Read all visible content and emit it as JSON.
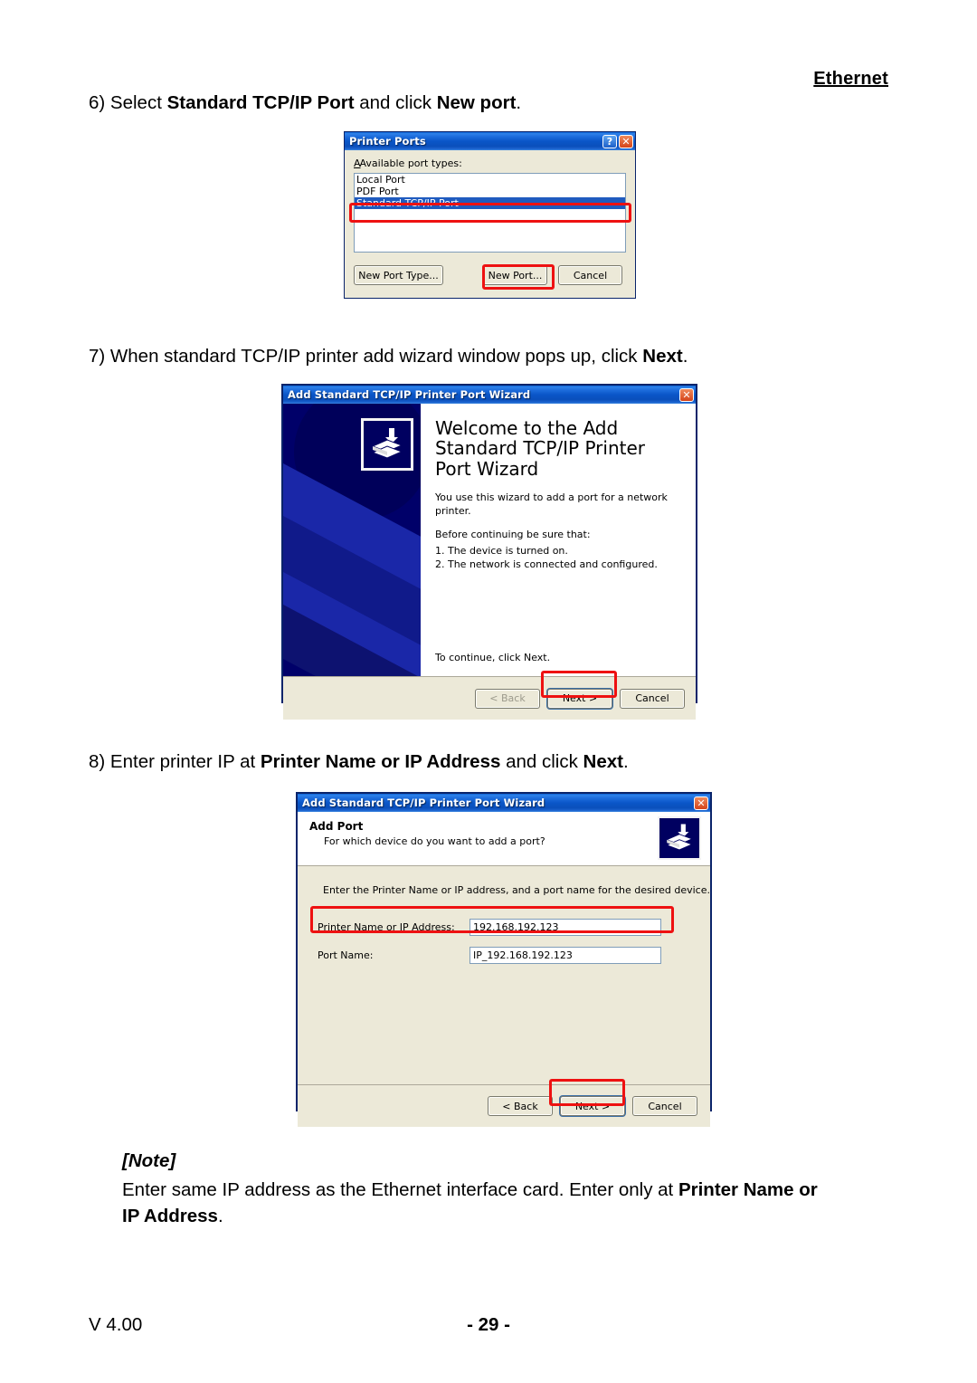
{
  "page": {
    "header_right": "Ethernet",
    "footer_left": "V 4.00",
    "footer_center": "- 29 -"
  },
  "steps": {
    "step6": {
      "prefix": "6) Select ",
      "bold1": "Standard TCP/IP Port",
      "middle": " and click ",
      "bold2": "New port",
      "suffix": "."
    },
    "step7": {
      "prefix": "7) When standard TCP/IP printer add wizard window pops up, click ",
      "bold1": "Next",
      "suffix": "."
    },
    "step8": {
      "prefix": "8) Enter printer IP at ",
      "bold1": "Printer Name or IP Address",
      "middle": " and click ",
      "bold2": "Next",
      "suffix": "."
    }
  },
  "note": {
    "label": "[Note]",
    "part1": "Enter same IP address as the Ethernet interface card. Enter only at ",
    "bold1": "Printer Name or",
    "bold2": "IP Address",
    "suffix": "."
  },
  "printer_ports_dialog": {
    "title": "Printer Ports",
    "help_glyph": "?",
    "close_glyph": "✕",
    "list_label": "Available port types:",
    "port_types": [
      {
        "label": "Local Port",
        "selected": false
      },
      {
        "label": "PDF Port",
        "selected": false
      },
      {
        "label": "Standard TCP/IP Port",
        "selected": true
      }
    ],
    "buttons": {
      "new_port_type": "New Port Type...",
      "new_port": "New Port...",
      "cancel": "Cancel"
    }
  },
  "wizard_welcome_dialog": {
    "title": "Add Standard TCP/IP Printer Port Wizard",
    "close_glyph": "✕",
    "heading": "Welcome to the Add Standard TCP/IP Printer Port Wizard",
    "intro": "You use this wizard to add a port for a network printer.",
    "before_label": "Before continuing be sure that:",
    "checklist": [
      "1.  The device is turned on.",
      "2.  The network is connected and configured."
    ],
    "continue_text": "To continue, click Next.",
    "buttons": {
      "back": "< Back",
      "next": "Next >",
      "cancel": "Cancel"
    }
  },
  "add_port_dialog": {
    "title": "Add Standard TCP/IP Printer Port Wizard",
    "close_glyph": "✕",
    "section_title": "Add Port",
    "section_subtitle": "For which device do you want to add a port?",
    "intro": "Enter the Printer Name or IP address, and a port name for the desired device.",
    "fields": [
      {
        "label": "Printer Name or IP Address:",
        "value": "192.168.192.123"
      },
      {
        "label": "Port Name:",
        "value": "IP_192.168.192.123"
      }
    ],
    "buttons": {
      "back": "< Back",
      "next": "Next >",
      "cancel": "Cancel"
    }
  },
  "colors": {
    "highlight_ring": "#ee1111",
    "titlebar_blue": "#0a56c8",
    "selection_blue": "#1f5bbf",
    "dialog_face": "#ece9d8",
    "wizard_panel": "#000069"
  }
}
